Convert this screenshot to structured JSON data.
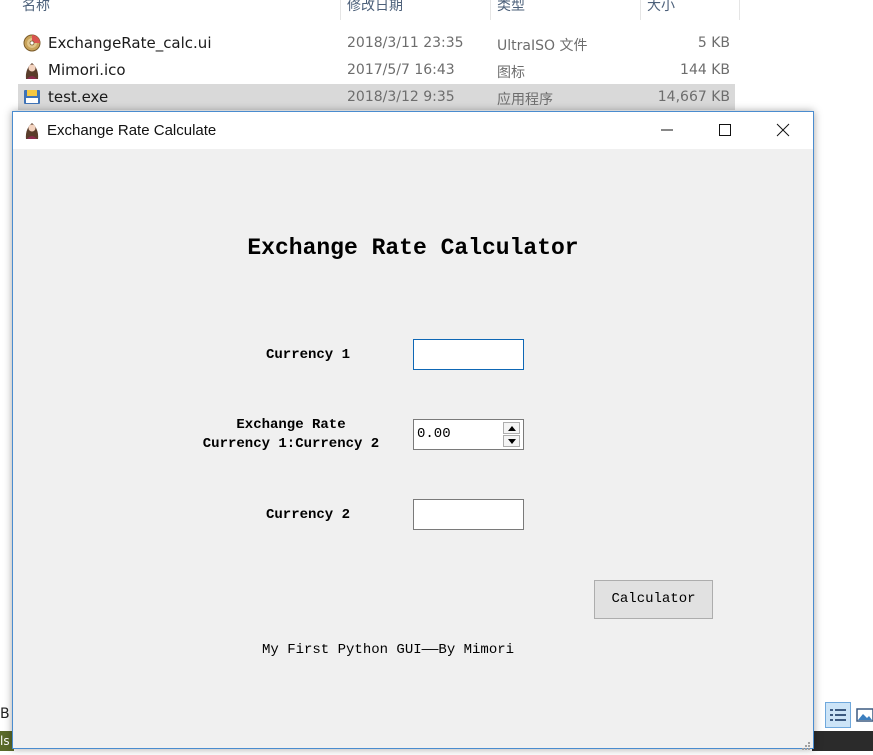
{
  "explorer": {
    "columns": {
      "name": "名称",
      "date": "修改日期",
      "type": "类型",
      "size": "大小"
    },
    "files": [
      {
        "name": "ExchangeRate_calc.ui",
        "date": "2018/3/11 23:35",
        "type": "UltraISO 文件",
        "size": "5 KB",
        "icon": "disc-file-icon",
        "selected": false
      },
      {
        "name": "Mimori.ico",
        "date": "2017/5/7 16:43",
        "type": "图标",
        "size": "144 KB",
        "icon": "avatar-file-icon",
        "selected": false
      },
      {
        "name": "test.exe",
        "date": "2018/3/12 9:35",
        "type": "应用程序",
        "size": "14,667 KB",
        "icon": "exe-file-icon",
        "selected": true
      }
    ],
    "status_left": "B",
    "taskbar_edge_text": "ls"
  },
  "window": {
    "title": "Exchange Rate Calculate",
    "controls": {
      "minimize": "minimize-icon",
      "maximize": "maximize-icon",
      "close": "close-icon"
    }
  },
  "app": {
    "heading": "Exchange Rate Calculator",
    "currency1_label": "Currency 1",
    "currency1_value": "",
    "rate_label_line1": "Exchange Rate",
    "rate_label_line2": "Currency 1:Currency 2",
    "rate_value": "0.00",
    "currency2_label": "Currency 2",
    "currency2_value": "",
    "calc_button": "Calculator",
    "footer": "My First Python GUI——By Mimori"
  },
  "colors": {
    "window_border": "#4a8ccf",
    "client_bg": "#f0f0f0",
    "selected_row": "#d9d9d9",
    "focus_border": "#0e67b5"
  }
}
